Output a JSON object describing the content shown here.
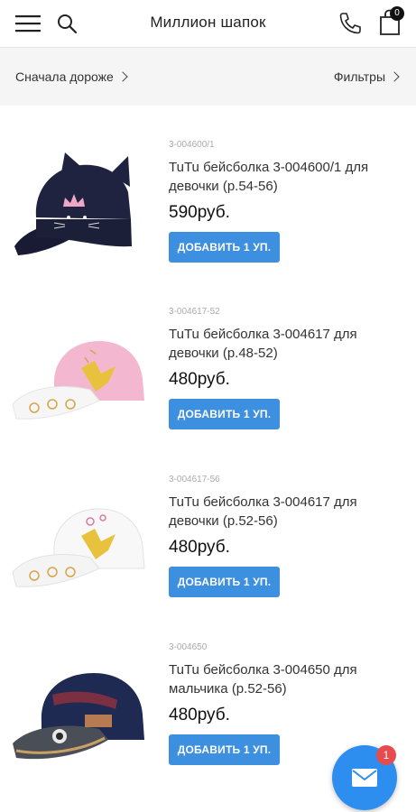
{
  "header": {
    "title": "Миллион шапок",
    "cart_count": "0"
  },
  "sortbar": {
    "sort_label": "Сначала дороже",
    "filters_label": "Фильтры"
  },
  "products": [
    {
      "sku": "3-004600/1",
      "name": "TuTu бейсболка 3-004600/1 для девочки (р.54-56)",
      "price": "590руб.",
      "button": "ДОБАВИТЬ 1 УП."
    },
    {
      "sku": "3-004617-52",
      "name": "TuTu бейсболка 3-004617 для девочки (р.48-52)",
      "price": "480руб.",
      "button": "ДОБАВИТЬ 1 УП."
    },
    {
      "sku": "3-004617-56",
      "name": "TuTu бейсболка 3-004617 для девочки (р.52-56)",
      "price": "480руб.",
      "button": "ДОБАВИТЬ 1 УП."
    },
    {
      "sku": "3-004650",
      "name": "TuTu бейсболка 3-004650 для мальчика (р.52-56)",
      "price": "480руб.",
      "button": "ДОБАВИТЬ 1 УП."
    }
  ],
  "chat": {
    "badge": "1"
  },
  "colors": {
    "accent": "#3d8fdf",
    "fab": "#2e8ef0",
    "badge": "#e74c4c"
  }
}
